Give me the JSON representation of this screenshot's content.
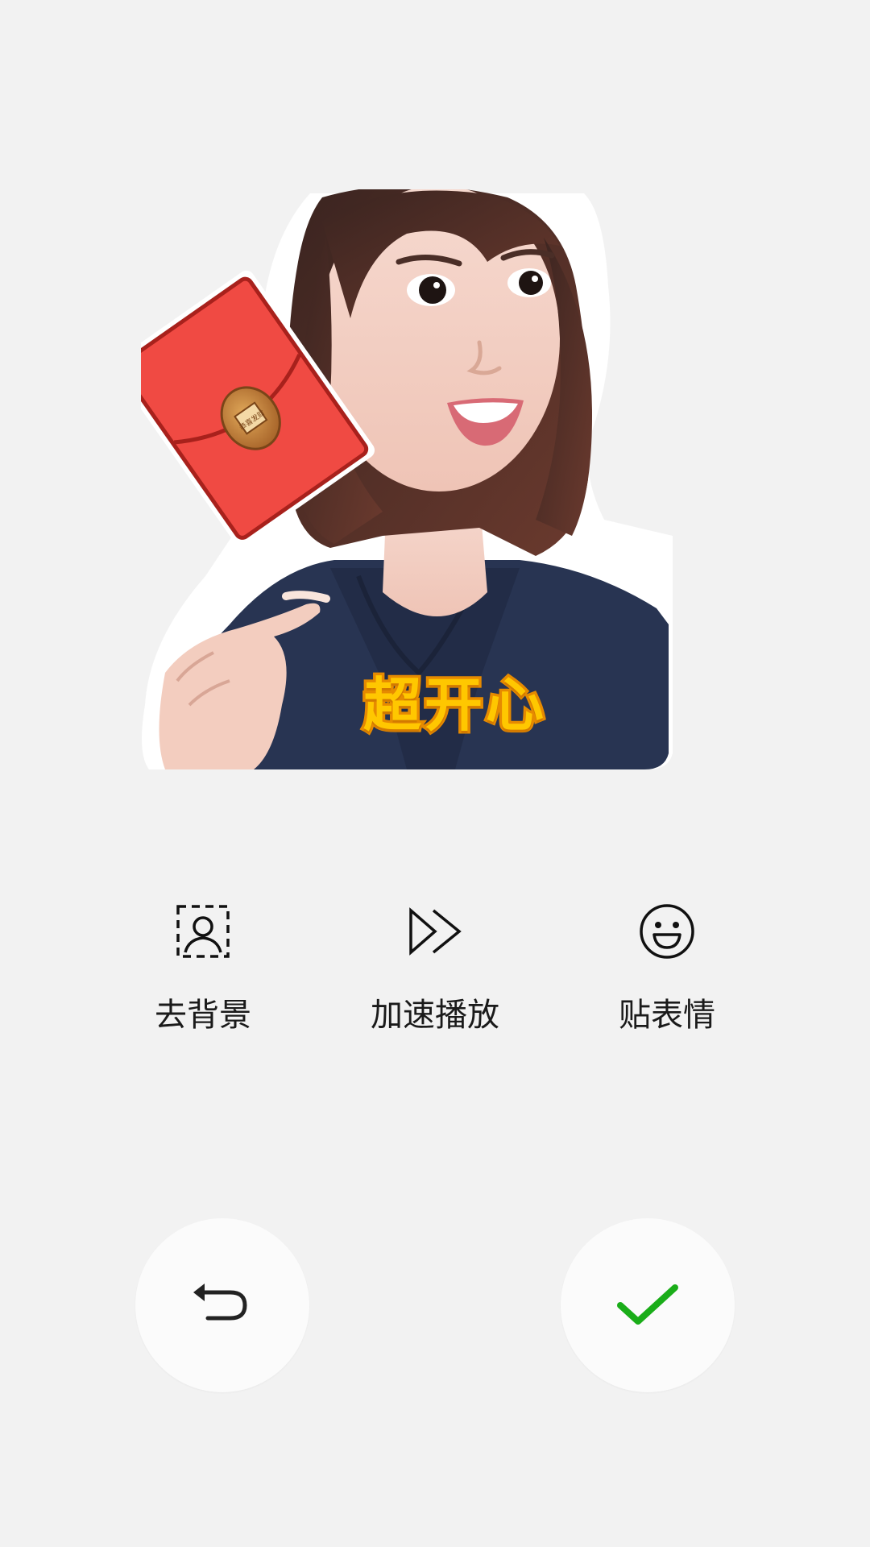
{
  "sticker": {
    "caption": "超开心",
    "envelope_coin_text": "恭喜发财"
  },
  "tools": [
    {
      "icon": "remove-background-icon",
      "label": "去背景"
    },
    {
      "icon": "fast-forward-icon",
      "label": "加速播放"
    },
    {
      "icon": "smiley-face-icon",
      "label": "贴表情"
    }
  ],
  "actions": {
    "undo_icon": "undo-arrow-icon",
    "confirm_icon": "checkmark-icon",
    "confirm_color": "#1aad19"
  },
  "colors": {
    "background": "#f2f2f2",
    "button_background": "#fbfbfb",
    "envelope_red": "#f04a43",
    "caption_yellow": "#ffc700",
    "caption_outline": "#e68a00"
  }
}
